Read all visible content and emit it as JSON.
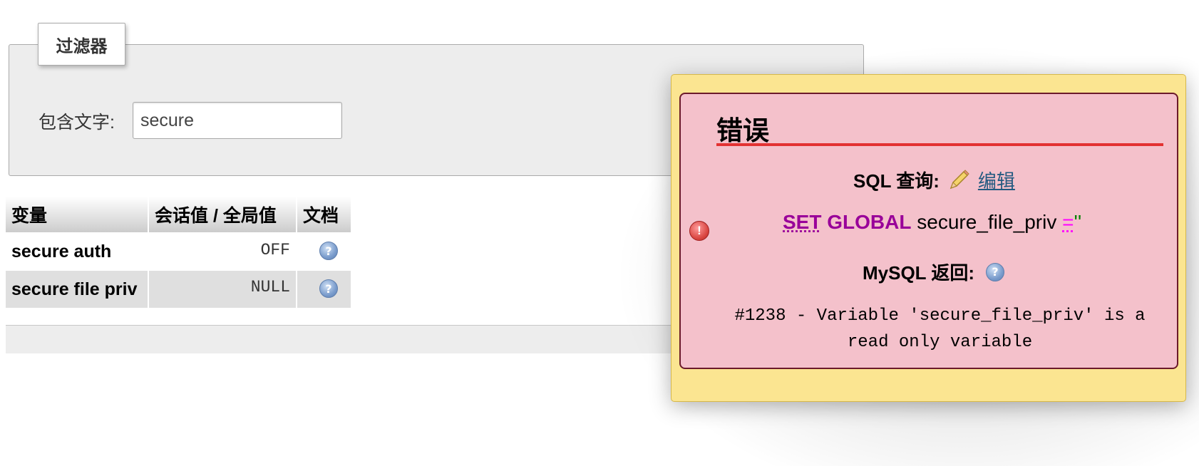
{
  "filter": {
    "legend": "过滤器",
    "label": "包含文字:",
    "value": "secure"
  },
  "table": {
    "headers": [
      "变量",
      "会话值 / 全局值",
      "文档"
    ],
    "rows": [
      {
        "name": "secure auth",
        "value": "OFF"
      },
      {
        "name": "secure file priv",
        "value": "NULL"
      }
    ]
  },
  "error_dialog": {
    "title": "错误",
    "sql_query_label": "SQL 查询:",
    "edit_link": "编辑",
    "sql": {
      "kw_set": "SET",
      "kw_global": "GLOBAL",
      "ident": "secure_file_priv",
      "op": "=",
      "str": "''"
    },
    "mysql_label": "MySQL 返回:",
    "message": "#1238 - Variable 'secure_file_priv' is a read only variable"
  },
  "icons": [
    "help-icon",
    "pencil-icon",
    "error-icon"
  ],
  "colors": {
    "dialog_bg": "#fbe591",
    "error_bg": "#f4c1cb",
    "error_rule": "#e33232",
    "keyword": "#990099",
    "link": "#235a81"
  }
}
